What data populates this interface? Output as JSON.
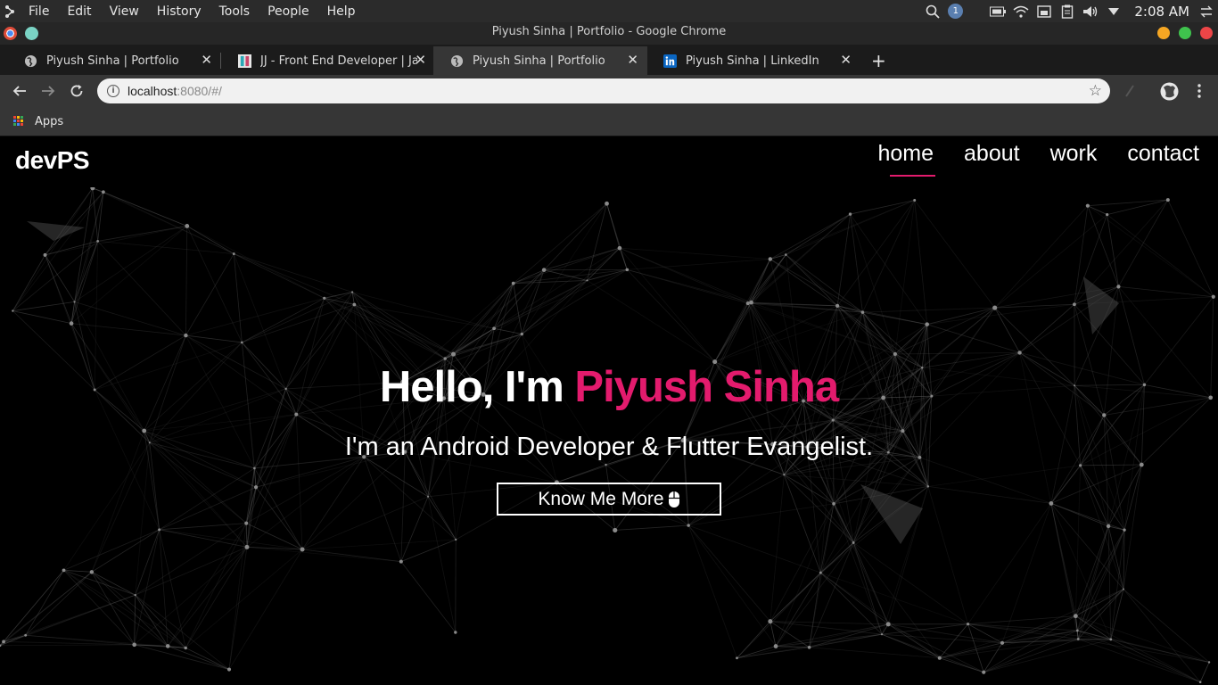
{
  "os": {
    "menu": [
      "File",
      "Edit",
      "View",
      "History",
      "Tools",
      "People",
      "Help"
    ],
    "notification_count": "1",
    "clock": "2:08 AM"
  },
  "window": {
    "title": "Piyush Sinha | Portfolio - Google Chrome"
  },
  "tabs": [
    {
      "title": "Piyush Sinha | Portfolio",
      "active": false
    },
    {
      "title": "JJ - Front End Developer | Java",
      "active": false
    },
    {
      "title": "Piyush Sinha | Portfolio",
      "active": true
    },
    {
      "title": "Piyush Sinha | LinkedIn",
      "active": false
    }
  ],
  "toolbar": {
    "url_host": "localhost",
    "url_rest": ":8080/#/"
  },
  "bookmarks": {
    "apps_label": "Apps"
  },
  "site": {
    "brand": "devPS",
    "nav": [
      "home",
      "about",
      "work",
      "contact"
    ],
    "active_nav": "home",
    "hero": {
      "greeting": "Hello, I'm ",
      "name": "Piyush Sinha",
      "subtitle": "I'm an Android Developer & Flutter Evangelist.",
      "cta_label": "Know Me More"
    }
  },
  "colors": {
    "accent": "#e31b6d",
    "page_bg": "#000000",
    "chrome_dark": "#363636"
  },
  "icons": {
    "os_logo": "kde-logo-icon",
    "search": "search-icon",
    "wifi": "wifi-icon",
    "volume": "volume-icon",
    "battery": "battery-icon",
    "star": "bookmark-star-icon",
    "cta": "mouse-icon"
  }
}
